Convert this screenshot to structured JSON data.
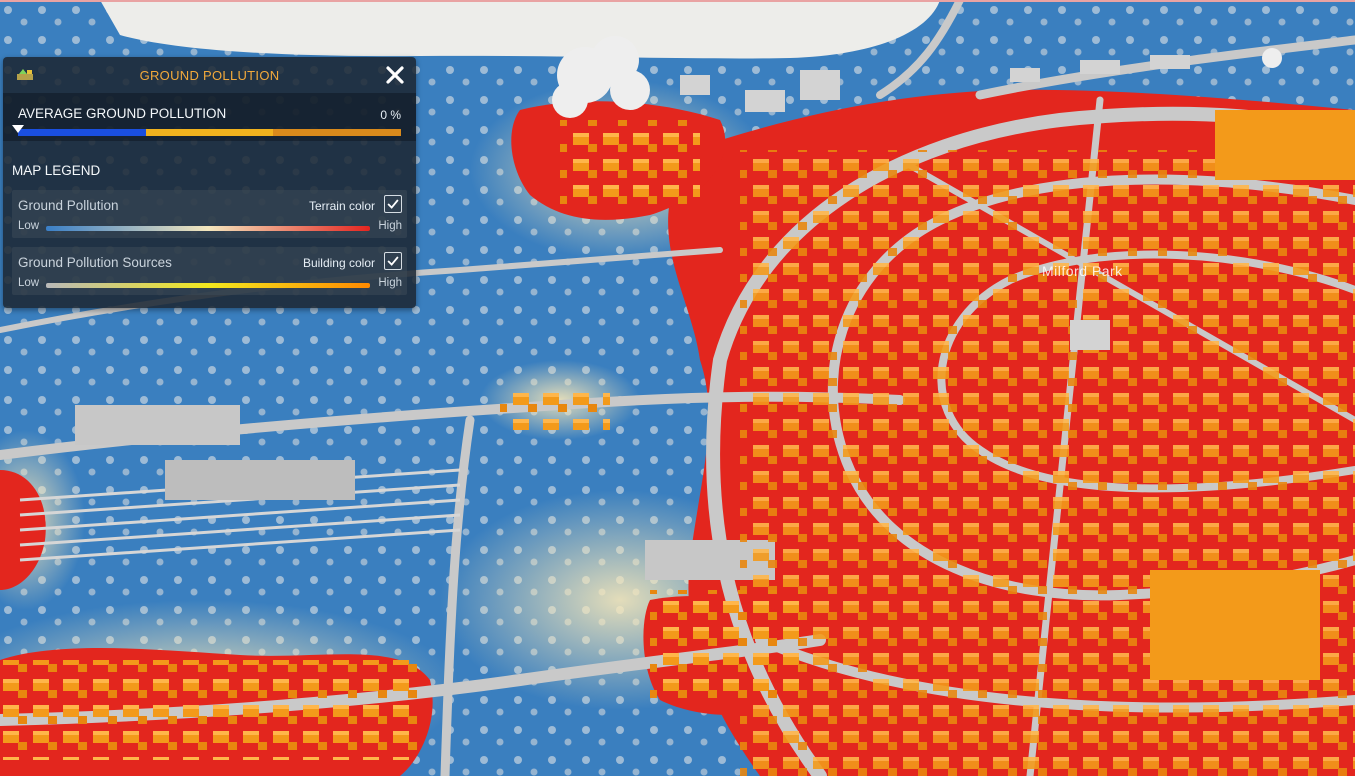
{
  "panel": {
    "title": "GROUND POLLUTION",
    "average": {
      "label": "AVERAGE GROUND POLLUTION",
      "value": "0 %",
      "level": 0,
      "segments": [
        "#1a4fe0",
        "#f0b21e",
        "#d98a1c"
      ]
    },
    "legend": {
      "heading": "MAP LEGEND",
      "items": [
        {
          "name": "Ground Pollution",
          "toggle_label": "Terrain color",
          "checked": true,
          "low": "Low",
          "high": "High",
          "gradient": [
            "#3a7fc7",
            "#f3e6bd",
            "#e52520"
          ]
        },
        {
          "name": "Ground Pollution Sources",
          "toggle_label": "Building color",
          "checked": true,
          "low": "Low",
          "high": "High",
          "gradient": [
            "#b9b9b9",
            "#f2e81e",
            "#ff8a00"
          ]
        }
      ]
    }
  },
  "map": {
    "district_label": "Milford Park",
    "colors": {
      "water": "#3a7fbf",
      "high_pollution": "#e3261e",
      "buildings": "#f39a1a",
      "roads": "#c8c8c8"
    }
  }
}
